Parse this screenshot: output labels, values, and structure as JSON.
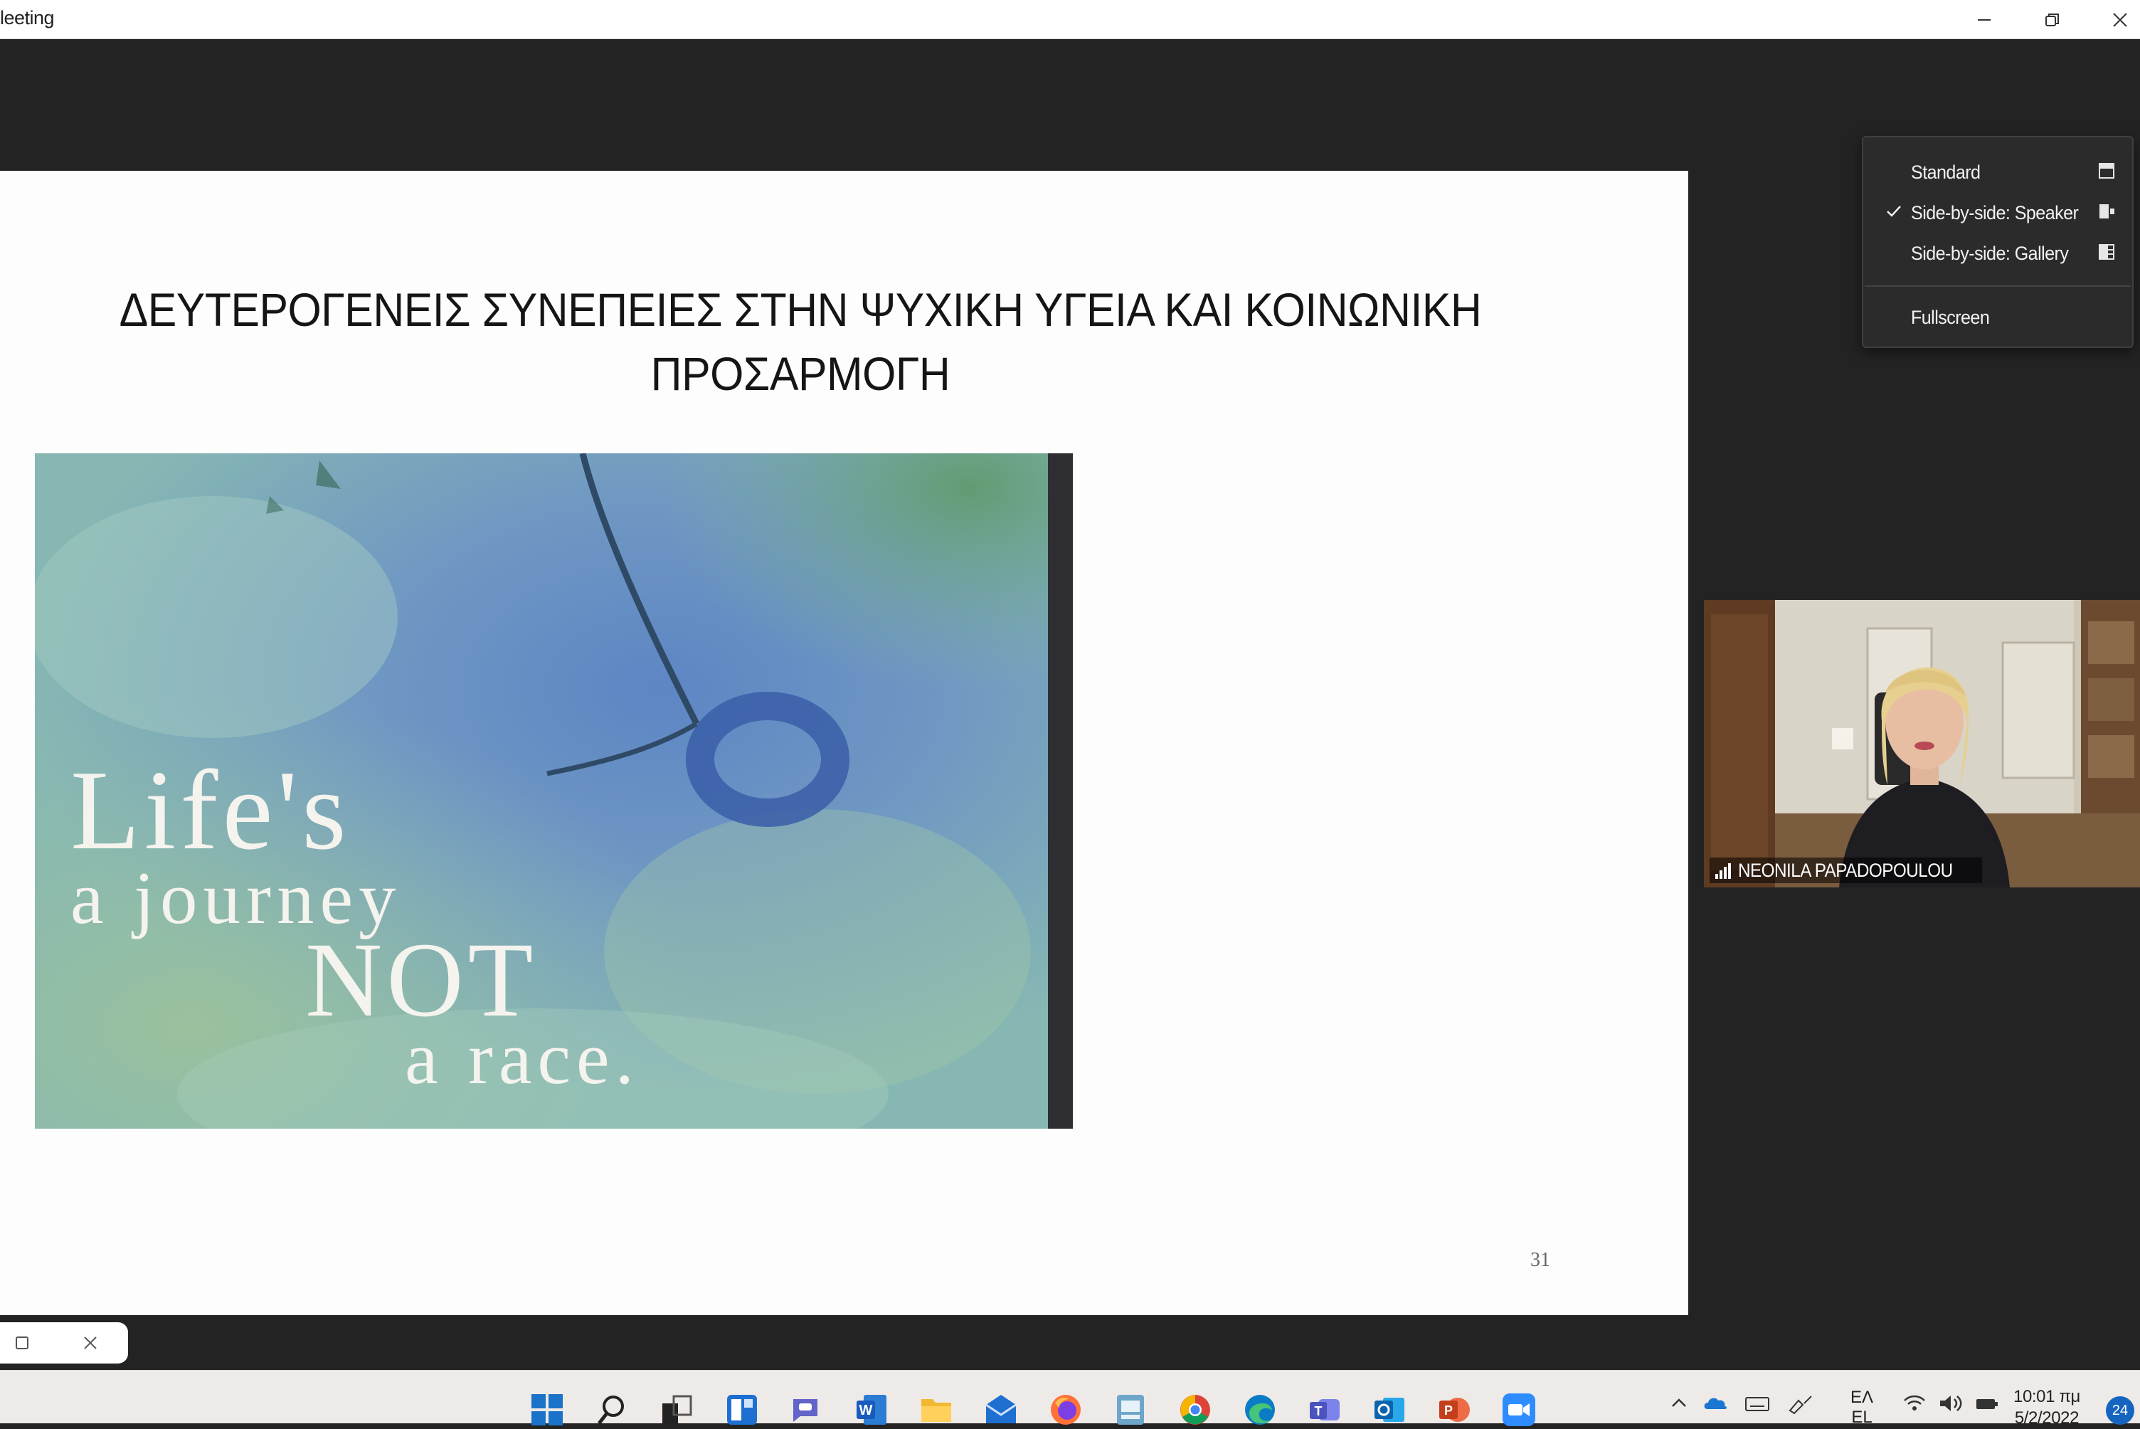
{
  "window": {
    "title": "leeting",
    "controls": {
      "minimize": "minimize-icon",
      "restore": "restore-icon",
      "close": "close-icon"
    }
  },
  "slide": {
    "title_line1": "ΔΕΥΤΕΡΟΓΕΝΕΙΣ ΣΥΝΕΠΕΙΕΣ ΣΤΗΝ ΨΥΧΙΚΗ ΥΓΕΙΑ ΚΑΙ ΚΟΙΝΩΝΙΚΗ",
    "title_line2": "ΠΡΟΣΑΡΜΟΓΗ",
    "image_text": [
      "Life's",
      "a journey",
      "NOT",
      "a race."
    ],
    "page_number": "31"
  },
  "view_menu": {
    "items": [
      {
        "label": "Standard",
        "checked": false,
        "icon": "standard-layout-icon"
      },
      {
        "label": "Side-by-side: Speaker",
        "checked": true,
        "icon": "side-by-side-speaker-icon"
      },
      {
        "label": "Side-by-side: Gallery",
        "checked": false,
        "icon": "side-by-side-gallery-icon"
      }
    ],
    "fullscreen_label": "Fullscreen"
  },
  "participant": {
    "name": "NEONILA PAPADOPOULOU",
    "signal_icon": "signal-strength-icon"
  },
  "taskbar": {
    "apps": [
      "windows-start-icon",
      "search-icon",
      "task-view-icon",
      "widgets-icon",
      "teams-chat-icon",
      "word-icon",
      "file-explorer-icon",
      "mail-icon",
      "firefox-icon",
      "app-icon",
      "chrome-icon",
      "edge-icon",
      "teams-icon",
      "outlook-icon",
      "powerpoint-icon",
      "zoom-icon"
    ],
    "tray": {
      "language_line1": "ΕΛ",
      "language_line2": "EL",
      "time": "10:01 πμ",
      "date": "5/2/2022",
      "notifications": "24"
    }
  },
  "colors": {
    "stage_background": "#232323",
    "menu_background": "#2b2b2b",
    "taskbar_background": "#eeeae8",
    "zoom_blue": "#2d8cff"
  }
}
